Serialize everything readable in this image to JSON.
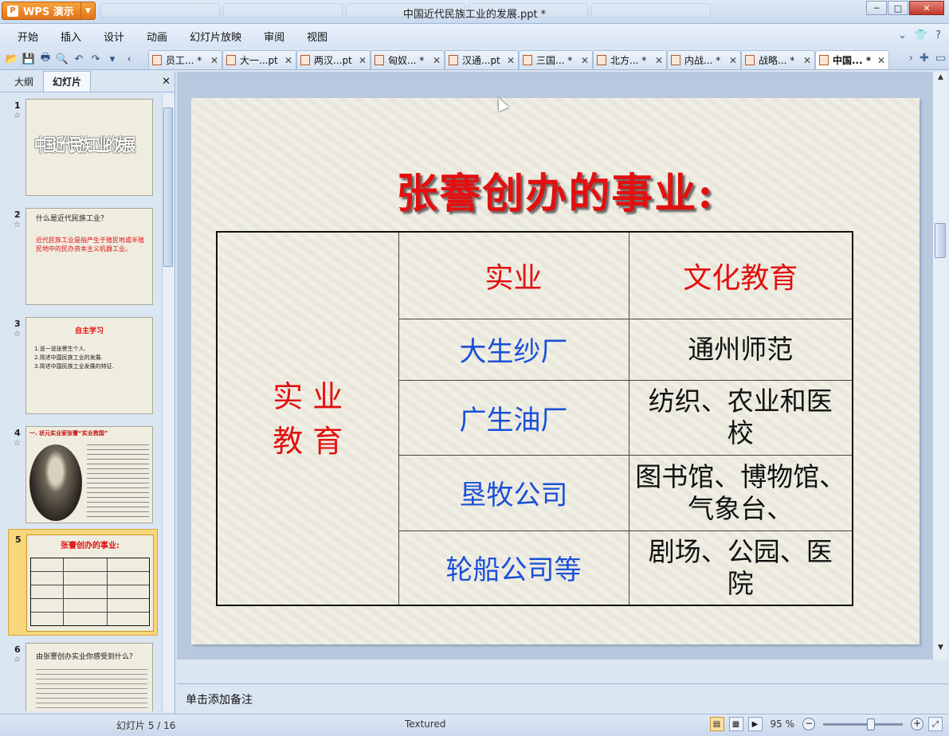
{
  "app": {
    "button_label": "WPS 演示",
    "window_title": "中国近代民族工业的发展.ppt *"
  },
  "menu": [
    "开始",
    "插入",
    "设计",
    "动画",
    "幻灯片放映",
    "审阅",
    "视图"
  ],
  "doc_tabs": [
    {
      "label": "员工... *"
    },
    {
      "label": "大一...pt"
    },
    {
      "label": "两汉...pt"
    },
    {
      "label": "匈奴... *"
    },
    {
      "label": "汉通...pt"
    },
    {
      "label": "三国... *"
    },
    {
      "label": "北方... *"
    },
    {
      "label": "内战... *"
    },
    {
      "label": "战略... *"
    },
    {
      "label": "中国... *"
    }
  ],
  "left_panel": {
    "tab_outline": "大纲",
    "tab_slides": "幻灯片",
    "thumbs": [
      {
        "num": "1",
        "title": "中国近代民族工业的发展"
      },
      {
        "num": "2",
        "q": "什么是近代民族工业？",
        "a": "近代民族工业是指产生于殖民地或半殖民地中的民办资本主义机器工业。"
      },
      {
        "num": "3",
        "title": "自主学习",
        "lines": [
          "1.说一说张謇生个人.",
          "2.简述中国民族工业的发展.",
          "3.简述中国民族工业发展的特征."
        ]
      },
      {
        "num": "4",
        "title": "一. 状元实业家张謇“实业救国”"
      },
      {
        "num": "5",
        "title": "张謇创办的事业:"
      },
      {
        "num": "6",
        "title": "由张謇创办实业你感受到什么？"
      }
    ]
  },
  "slide": {
    "title": "张謇创办的事业:",
    "left_cell": [
      "实 业",
      "教 育"
    ],
    "headers": [
      "实业",
      "文化教育"
    ],
    "rows": [
      {
        "industry": "大生纱厂",
        "culture": "通州师范"
      },
      {
        "industry": "广生油厂",
        "culture": "纺织、农业和医校"
      },
      {
        "industry": "垦牧公司",
        "culture": "图书馆、博物馆、气象台、"
      },
      {
        "industry": "轮船公司等",
        "culture": "剧场、公园、医院"
      }
    ]
  },
  "notes_placeholder": "单击添加备注",
  "status": {
    "slide_counter": "幻灯片 5 / 16",
    "theme": "Textured",
    "zoom": "95 %"
  }
}
